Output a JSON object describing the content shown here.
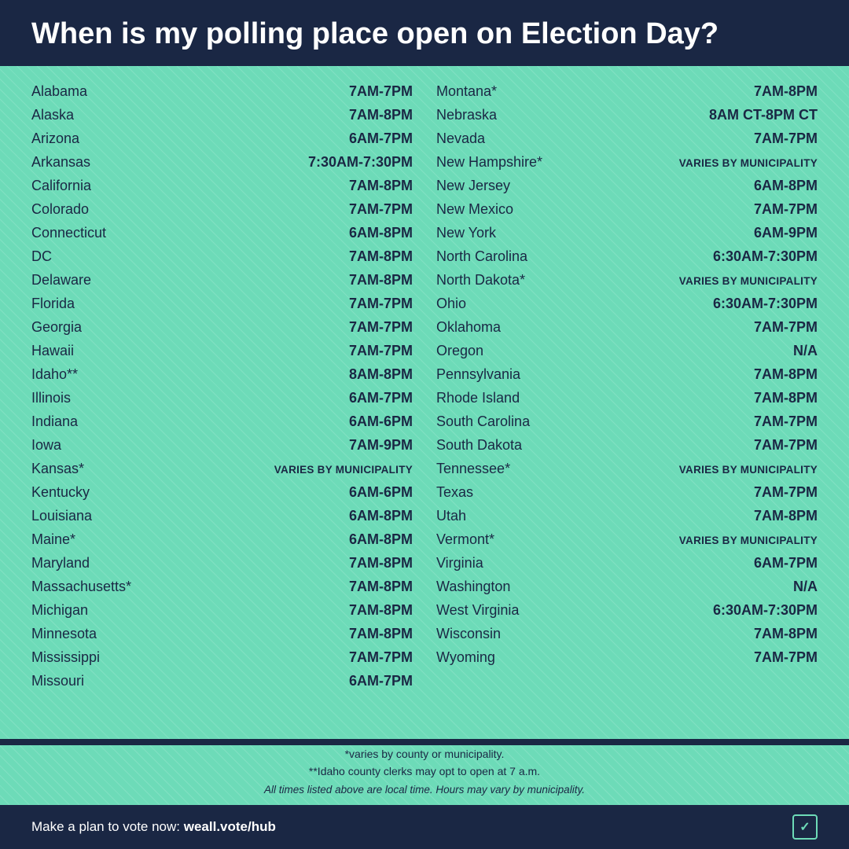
{
  "header": {
    "title": "When is my polling place open on Election Day?"
  },
  "left_column": [
    {
      "state": "Alabama",
      "hours": "7AM-7PM"
    },
    {
      "state": "Alaska",
      "hours": "7AM-8PM"
    },
    {
      "state": "Arizona",
      "hours": "6AM-7PM"
    },
    {
      "state": "Arkansas",
      "hours": "7:30AM-7:30PM"
    },
    {
      "state": "California",
      "hours": "7AM-8PM"
    },
    {
      "state": "Colorado",
      "hours": "7AM-7PM"
    },
    {
      "state": "Connecticut",
      "hours": "6AM-8PM"
    },
    {
      "state": "DC",
      "hours": "7AM-8PM"
    },
    {
      "state": "Delaware",
      "hours": "7AM-8PM"
    },
    {
      "state": "Florida",
      "hours": "7AM-7PM"
    },
    {
      "state": "Georgia",
      "hours": "7AM-7PM"
    },
    {
      "state": "Hawaii",
      "hours": "7AM-7PM"
    },
    {
      "state": "Idaho**",
      "hours": "8AM-8PM"
    },
    {
      "state": "Illinois",
      "hours": "6AM-7PM"
    },
    {
      "state": "Indiana",
      "hours": "6AM-6PM"
    },
    {
      "state": "Iowa",
      "hours": "7AM-9PM"
    },
    {
      "state": "Kansas*",
      "hours": "VARIES BY MUNICIPALITY",
      "varies": true
    },
    {
      "state": "Kentucky",
      "hours": "6AM-6PM"
    },
    {
      "state": "Louisiana",
      "hours": "6AM-8PM"
    },
    {
      "state": "Maine*",
      "hours": "6AM-8PM"
    },
    {
      "state": "Maryland",
      "hours": "7AM-8PM"
    },
    {
      "state": "Massachusetts*",
      "hours": "7AM-8PM"
    },
    {
      "state": "Michigan",
      "hours": "7AM-8PM"
    },
    {
      "state": "Minnesota",
      "hours": "7AM-8PM"
    },
    {
      "state": "Mississippi",
      "hours": "7AM-7PM"
    },
    {
      "state": "Missouri",
      "hours": "6AM-7PM"
    }
  ],
  "right_column": [
    {
      "state": "Montana*",
      "hours": "7AM-8PM"
    },
    {
      "state": "Nebraska",
      "hours": "8AM CT-8PM CT"
    },
    {
      "state": "Nevada",
      "hours": "7AM-7PM"
    },
    {
      "state": "New Hampshire*",
      "hours": "VARIES BY MUNICIPALITY",
      "varies": true
    },
    {
      "state": "New Jersey",
      "hours": "6AM-8PM"
    },
    {
      "state": "New Mexico",
      "hours": "7AM-7PM"
    },
    {
      "state": "New York",
      "hours": "6AM-9PM"
    },
    {
      "state": "North Carolina",
      "hours": "6:30AM-7:30PM"
    },
    {
      "state": "North Dakota*",
      "hours": "VARIES BY MUNICIPALITY",
      "varies": true
    },
    {
      "state": "Ohio",
      "hours": "6:30AM-7:30PM"
    },
    {
      "state": "Oklahoma",
      "hours": "7AM-7PM"
    },
    {
      "state": "Oregon",
      "hours": "N/A"
    },
    {
      "state": "Pennsylvania",
      "hours": "7AM-8PM"
    },
    {
      "state": "Rhode Island",
      "hours": "7AM-8PM"
    },
    {
      "state": "South Carolina",
      "hours": "7AM-7PM"
    },
    {
      "state": "South Dakota",
      "hours": "7AM-7PM"
    },
    {
      "state": "Tennessee*",
      "hours": "VARIES BY MUNICIPALITY",
      "varies": true
    },
    {
      "state": "Texas",
      "hours": "7AM-7PM"
    },
    {
      "state": "Utah",
      "hours": "7AM-8PM"
    },
    {
      "state": "Vermont*",
      "hours": "VARIES BY MUNICIPALITY",
      "varies": true
    },
    {
      "state": "Virginia",
      "hours": "6AM-7PM"
    },
    {
      "state": "Washington",
      "hours": "N/A"
    },
    {
      "state": "West Virginia",
      "hours": "6:30AM-7:30PM"
    },
    {
      "state": "Wisconsin",
      "hours": "7AM-8PM"
    },
    {
      "state": "Wyoming",
      "hours": "7AM-7PM"
    }
  ],
  "footnotes": {
    "note1": "*varies by county or municipality.",
    "note2": "**Idaho county clerks may opt to open at 7 a.m.",
    "note3": "All times listed above are local time. Hours may vary by municipality."
  },
  "footer": {
    "cta_text": "Make a plan to vote now: ",
    "cta_link": "weall.vote/hub"
  }
}
